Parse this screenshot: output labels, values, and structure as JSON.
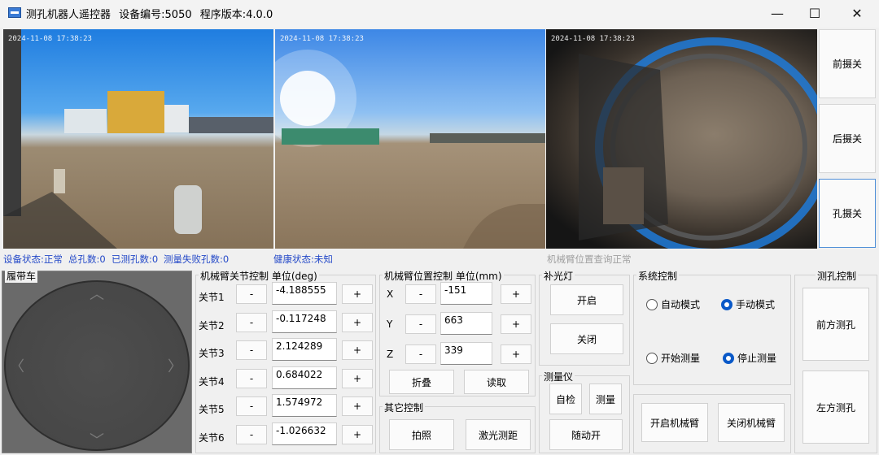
{
  "window": {
    "title": "测孔机器人遥控器",
    "device_label": "设备编号:5050",
    "version_label": "程序版本:4.0.0",
    "minimize_glyph": "—",
    "maximize_glyph": "☐",
    "close_glyph": "✕"
  },
  "cameras": [
    {
      "timestamp": "2024-11-08 17:38:23"
    },
    {
      "timestamp": "2024-11-08 17:38:23"
    },
    {
      "timestamp": "2024-11-08 17:38:23"
    }
  ],
  "camera_buttons": {
    "front": "前摄关",
    "rear": "后摄关",
    "hole": "孔摄关"
  },
  "status": {
    "device": "设备状态:正常",
    "total_holes": "总孔数:0",
    "measured_holes": "已测孔数:0",
    "failed_holes": "测量失败孔数:0",
    "health": "健康状态:未知",
    "arm_query": "机械臂位置查询正常"
  },
  "crawler": {
    "label": "履带车",
    "arrows": {
      "up": "︿",
      "down": "﹀",
      "left": "〈",
      "right": "〉"
    }
  },
  "joint_control": {
    "title": "机械臂关节控制 单位(deg)",
    "minus": "-",
    "plus": "+",
    "joints": [
      {
        "label": "关节1",
        "value": "-4.188555"
      },
      {
        "label": "关节2",
        "value": "-0.117248"
      },
      {
        "label": "关节3",
        "value": "2.124289"
      },
      {
        "label": "关节4",
        "value": "0.684022"
      },
      {
        "label": "关节5",
        "value": "1.574972"
      },
      {
        "label": "关节6",
        "value": "-1.026632"
      }
    ]
  },
  "position_control": {
    "title": "机械臂位置控制 单位(mm)",
    "minus": "-",
    "plus": "+",
    "axes": [
      {
        "label": "X",
        "value": "-151"
      },
      {
        "label": "Y",
        "value": "663"
      },
      {
        "label": "Z",
        "value": "339"
      }
    ],
    "fold": "折叠",
    "read": "读取"
  },
  "other_control": {
    "title": "其它控制",
    "photo": "拍照",
    "laser": "激光测距"
  },
  "fill_light": {
    "title": "补光灯",
    "on": "开启",
    "off": "关闭"
  },
  "meter": {
    "title": "测量仪",
    "self_check": "自检",
    "measure": "测量",
    "follow": "随动开"
  },
  "system_control": {
    "title": "系统控制",
    "auto_mode": "自动模式",
    "manual_mode": "手动模式",
    "start_measure": "开始测量",
    "stop_measure": "停止测量",
    "selected_mode": "manual",
    "selected_run": "stop",
    "open_arm": "开启机械臂",
    "close_arm": "关闭机械臂"
  },
  "hole_control": {
    "title": "测孔控制",
    "front": "前方测孔",
    "left": "左方测孔"
  }
}
